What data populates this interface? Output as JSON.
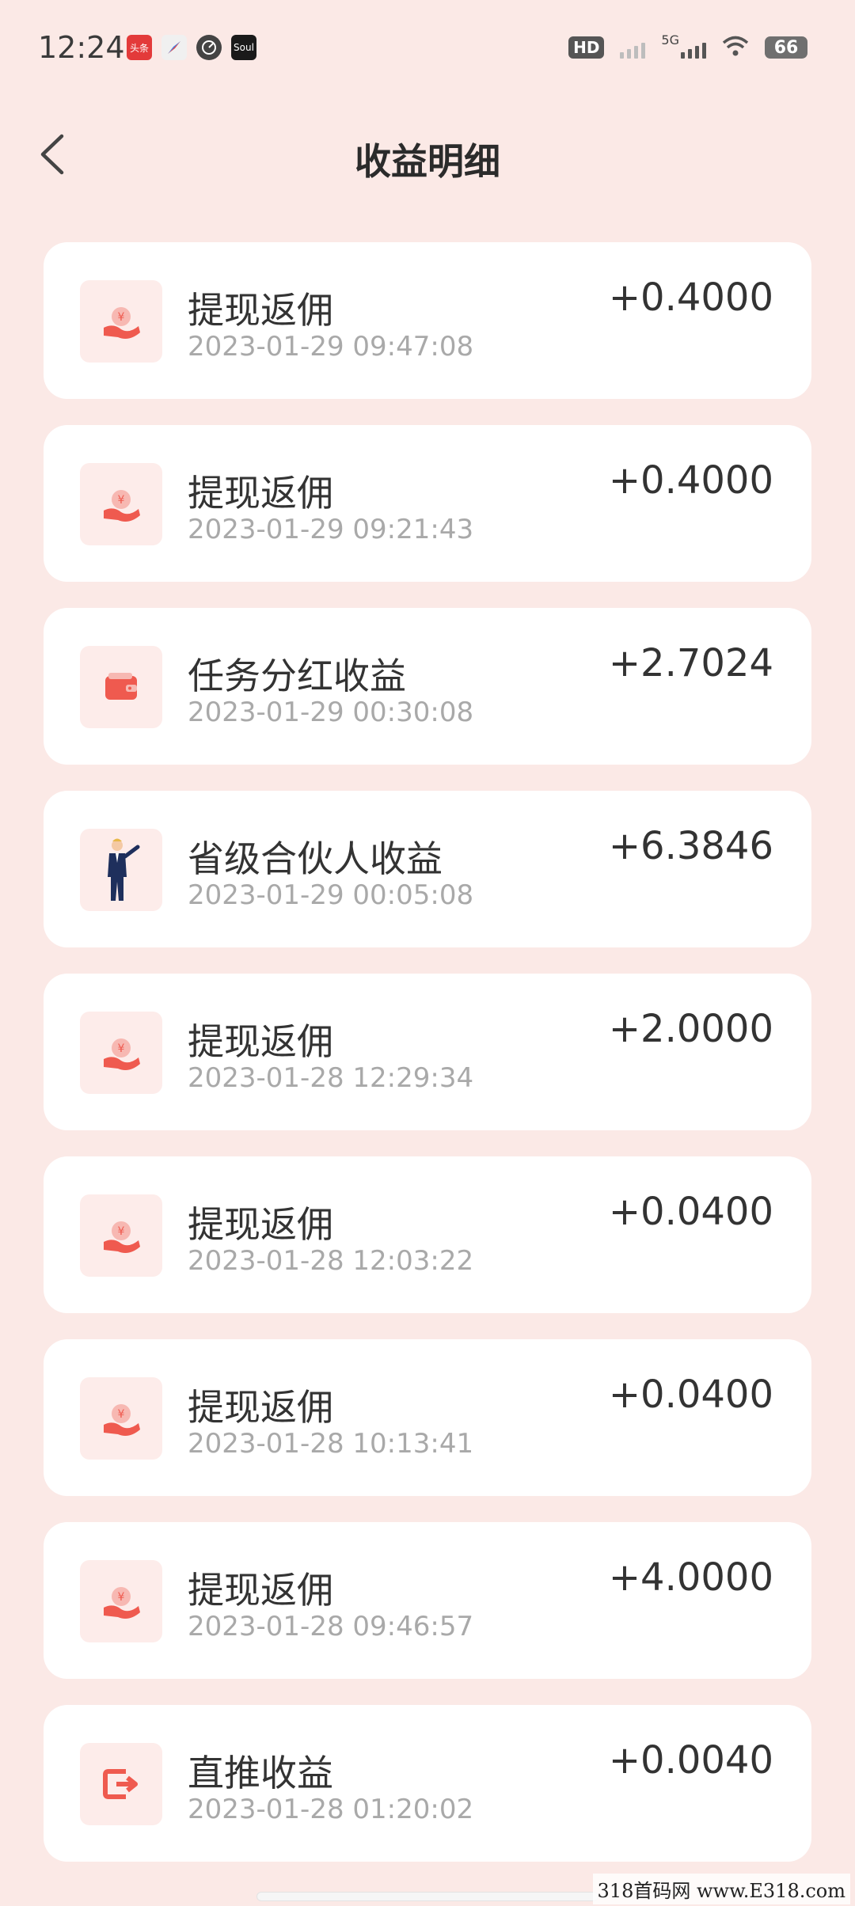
{
  "status_bar": {
    "time": "12:24",
    "app_icon_labels": [
      "头条",
      "",
      "",
      "Soul"
    ],
    "hd_label": "HD",
    "network": "5G",
    "battery": "66"
  },
  "header": {
    "title": "收益明细",
    "back_icon": "chevron-left-icon"
  },
  "colors": {
    "background": "#fbe9e6",
    "card": "#ffffff",
    "icon_accent": "#ef5a4f",
    "date_text": "#a9a9a9"
  },
  "transactions": [
    {
      "title": "提现返佣",
      "time": "2023-01-29 09:47:08",
      "amount": "+0.4000",
      "icon": "hand-coin-icon"
    },
    {
      "title": "提现返佣",
      "time": "2023-01-29 09:21:43",
      "amount": "+0.4000",
      "icon": "hand-coin-icon"
    },
    {
      "title": "任务分红收益",
      "time": "2023-01-29 00:30:08",
      "amount": "+2.7024",
      "icon": "wallet-icon"
    },
    {
      "title": "省级合伙人收益",
      "time": "2023-01-29 00:05:08",
      "amount": "+6.3846",
      "icon": "businessman-icon"
    },
    {
      "title": "提现返佣",
      "time": "2023-01-28 12:29:34",
      "amount": "+2.0000",
      "icon": "hand-coin-icon"
    },
    {
      "title": "提现返佣",
      "time": "2023-01-28 12:03:22",
      "amount": "+0.0400",
      "icon": "hand-coin-icon"
    },
    {
      "title": "提现返佣",
      "time": "2023-01-28 10:13:41",
      "amount": "+0.0400",
      "icon": "hand-coin-icon"
    },
    {
      "title": "提现返佣",
      "time": "2023-01-28 09:46:57",
      "amount": "+4.0000",
      "icon": "hand-coin-icon"
    },
    {
      "title": "直推收益",
      "time": "2023-01-28 01:20:02",
      "amount": "+0.0040",
      "icon": "export-arrow-icon"
    }
  ],
  "watermark": "318首码网 www.E318.com"
}
